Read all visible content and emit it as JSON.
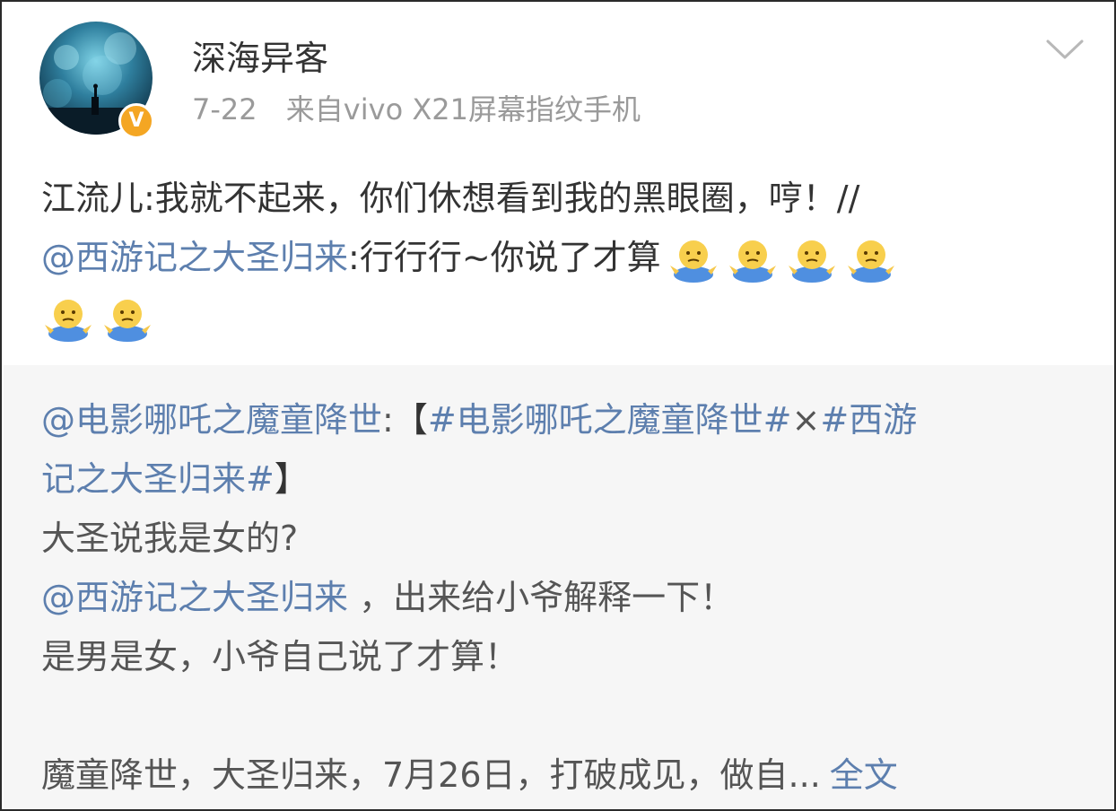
{
  "post": {
    "username": "深海异客",
    "date": "7-22",
    "source": "来自vivo X21屏幕指纹手机",
    "verified_badge": "V",
    "content": {
      "line1": "江流儿:我就不起来，你们休想看到我的黑眼圈，哼！//",
      "mention": "@西游记之大圣归来",
      "line2_text": ":行行行~你说了才算"
    },
    "emoji_name": "shrug-emoji"
  },
  "repost": {
    "author": "@电影哪吒之魔童降世",
    "colon": ":",
    "bracket_open": "【",
    "topic1": "#电影哪吒之魔童降世#",
    "times": "×",
    "topic2_part1": "#西游",
    "topic2_part2": "记之大圣归来#",
    "bracket_close": "】",
    "line3": "大圣说我是女的?",
    "mention": "@西游记之大圣归来",
    "line4_text": " ，出来给小爷解释一下！",
    "line5": "是男是女，小爷自己说了才算！",
    "line6": "魔童降世，大圣归来，7月26日，打破成见，做自...",
    "full_text_link": "全文"
  },
  "colors": {
    "link": "#5d7fae",
    "badge": "#f4a623",
    "repost_bg": "#f6f6f6",
    "meta_text": "#9a9a9a"
  }
}
